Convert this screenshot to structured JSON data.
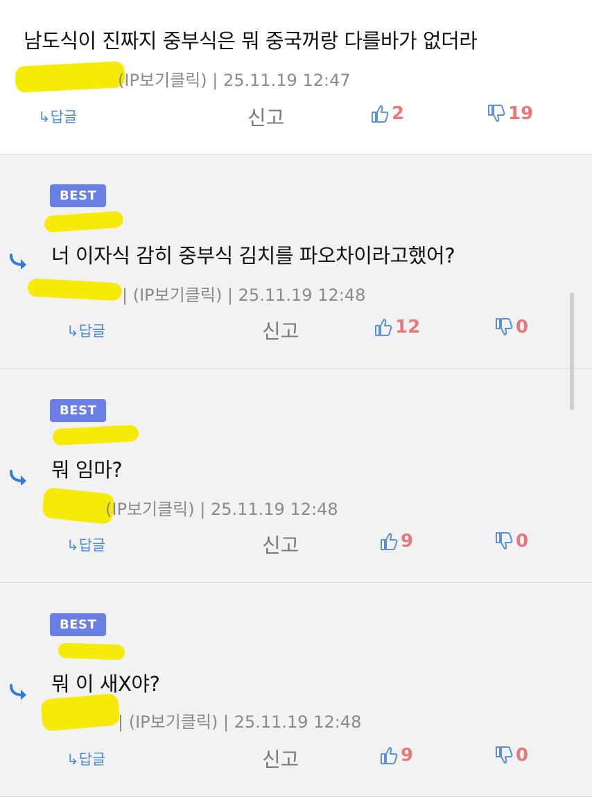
{
  "comments": [
    {
      "best": "",
      "text": "남도식이 진짜지 중부식은 뭐 중국꺼랑 다를바가 없더라",
      "ip": "(IP보기클릭)",
      "date": "25.11.19 12:47",
      "reply_label": "↳답글",
      "report_label": "신고",
      "likes": "2",
      "dislikes": "19"
    },
    {
      "best": "BEST",
      "text": "너 이자식 감히 중부식 김치를 파오차이라고했어?",
      "ip": "(IP보기클릭)",
      "date": "25.11.19 12:48",
      "reply_label": "↳답글",
      "report_label": "신고",
      "likes": "12",
      "dislikes": "0"
    },
    {
      "best": "BEST",
      "text": "뭐 임마?",
      "ip": "(IP보기클릭)",
      "date": "25.11.19 12:48",
      "reply_label": "↳답글",
      "report_label": "신고",
      "likes": "9",
      "dislikes": "0"
    },
    {
      "best": "BEST",
      "text": "뭐 이 새X야?",
      "ip": "(IP보기클릭)",
      "date": "25.11.19 12:48",
      "reply_label": "↳답글",
      "report_label": "신고",
      "likes": "9",
      "dislikes": "0"
    }
  ],
  "colors": {
    "accent_blue": "#4a8ad8",
    "best_badge": "#6a7fe6",
    "count_red": "#e6787a",
    "reply_bg": "#f2f2f4",
    "redaction_yellow": "#f6ea00"
  },
  "icons": {
    "like": "thumbs-up-icon",
    "dislike": "thumbs-down-icon",
    "reply_arrow": "reply-arrow-icon"
  }
}
